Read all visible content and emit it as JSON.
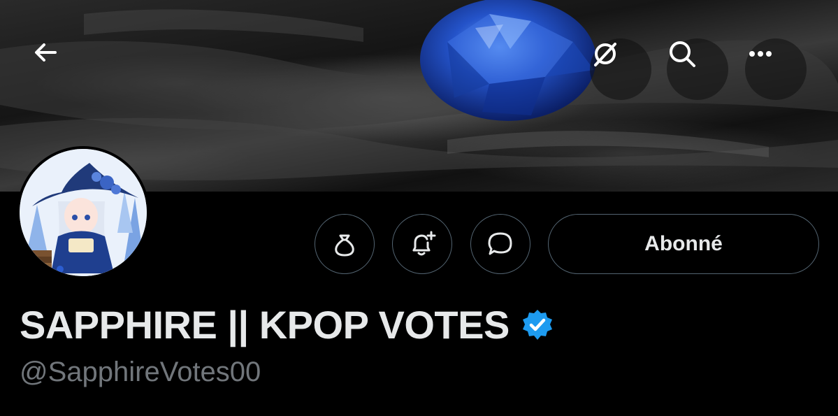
{
  "header": {
    "back_icon": "arrow-left-icon",
    "grok_icon": "grok-icon",
    "search_icon": "search-icon",
    "more_icon": "ellipsis-icon"
  },
  "profile": {
    "display_name": "SAPPHIRE || KPOP VOTES",
    "handle": "@SapphireVotes00",
    "verified": true,
    "verified_color": "#1d9bf0"
  },
  "actions": {
    "tip_icon": "money-bag-icon",
    "notify_icon": "bell-plus-icon",
    "message_icon": "message-bubble-icon",
    "follow_label": "Abonné"
  },
  "colors": {
    "background": "#000000",
    "text_primary": "#e7e9ea",
    "text_secondary": "#71767b",
    "border": "#536471"
  }
}
